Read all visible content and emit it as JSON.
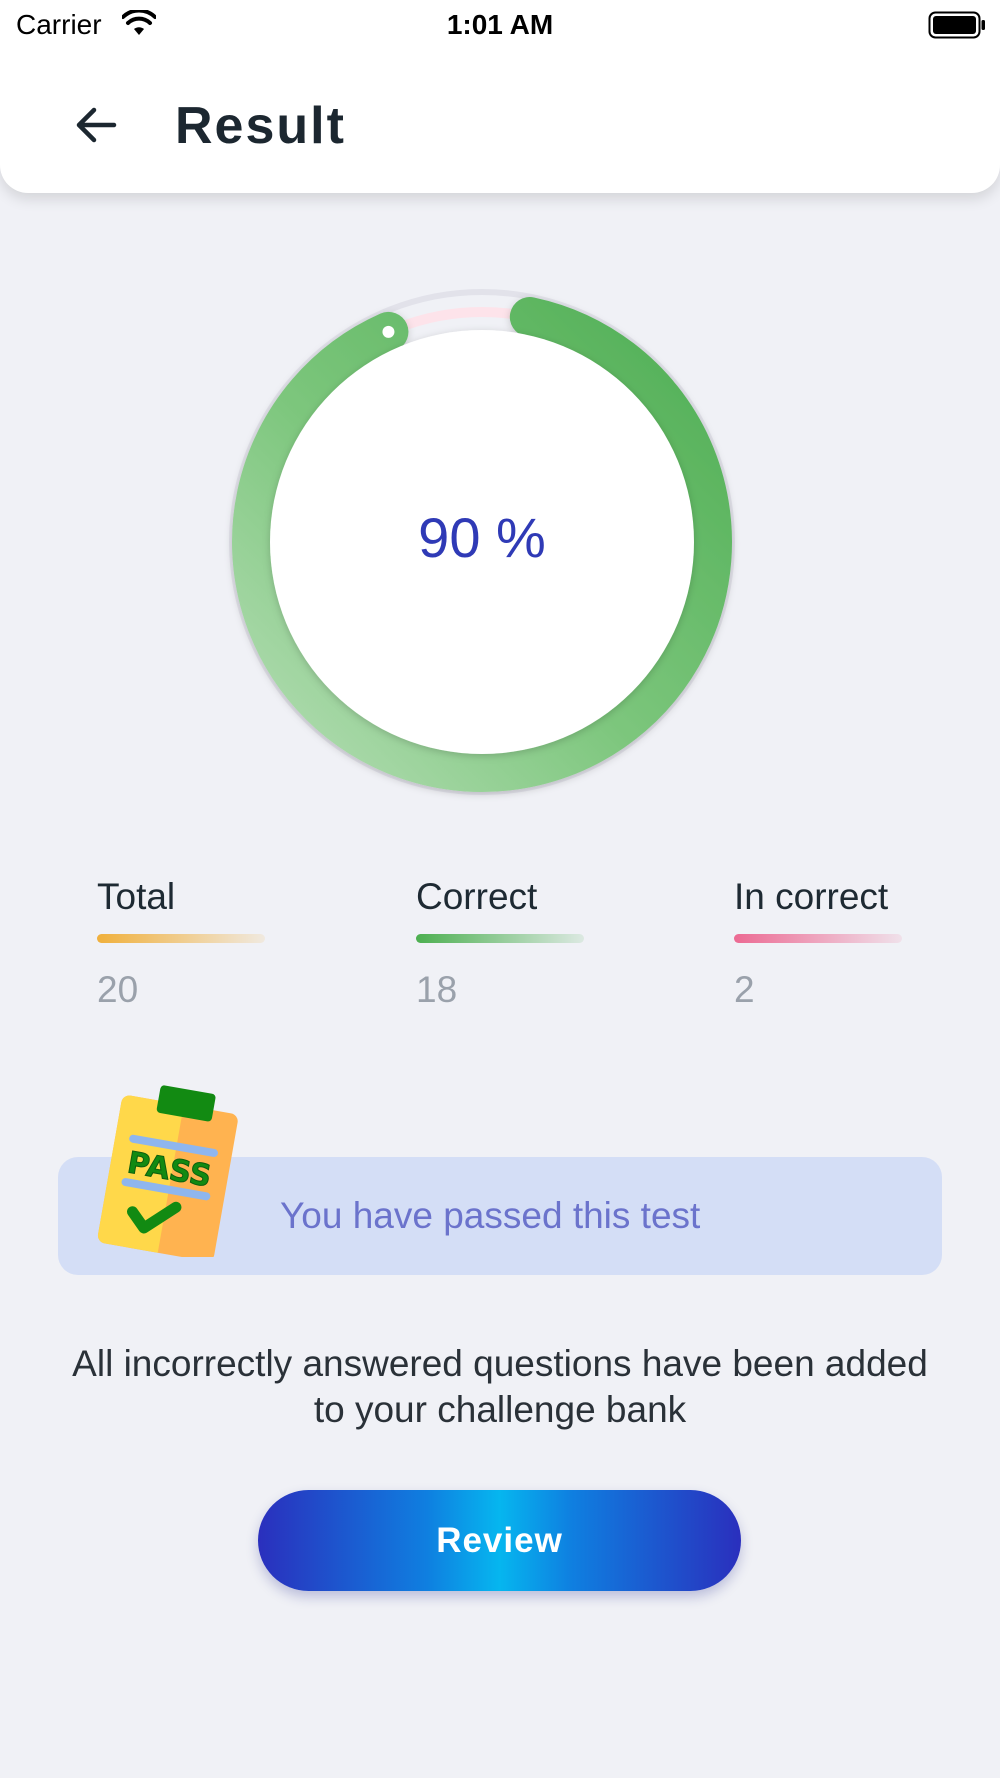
{
  "status_bar": {
    "carrier": "Carrier",
    "time": "1:01 AM"
  },
  "header": {
    "title": "Result"
  },
  "score": {
    "display": "90 %",
    "percent": 90,
    "track_color": "#fde3ea",
    "progress_color": "#5cb85c"
  },
  "stats": [
    {
      "label": "Total",
      "value": "20",
      "color": "#f0b03c"
    },
    {
      "label": "Correct",
      "value": "18",
      "color": "#4caf50"
    },
    {
      "label": "In correct",
      "value": "2",
      "color": "#ec6a93"
    }
  ],
  "banner": {
    "text": "You have passed this test",
    "icon": "pass-clipboard-icon"
  },
  "info": {
    "text": "All incorrectly answered questions have been added to your challenge bank"
  },
  "review_button": {
    "label": "Review"
  }
}
